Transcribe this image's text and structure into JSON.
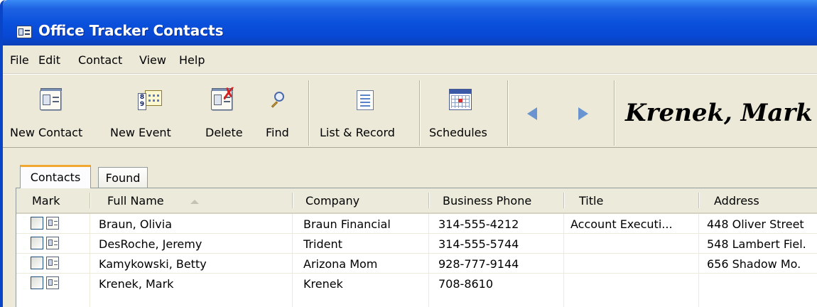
{
  "window": {
    "title": "Office Tracker Contacts"
  },
  "menu": [
    "File",
    "Edit",
    "Contact",
    "View",
    "Help"
  ],
  "toolbar": {
    "new_contact": "New Contact",
    "new_event": "New Event",
    "delete": "Delete",
    "find": "Find",
    "list_record": "List & Record",
    "schedules": "Schedules"
  },
  "current_contact": "Krenek, Mark",
  "tabs": [
    "Contacts",
    "Found"
  ],
  "table": {
    "columns": [
      "Mark",
      "Full Name",
      "Company",
      "Business Phone",
      "Title",
      "Address"
    ],
    "sort_column": "Full Name",
    "rows": [
      {
        "full_name": "Braun, Olivia",
        "company": "Braun Financial",
        "phone": "314-555-4212",
        "title": "Account Executi...",
        "address": "448 Oliver Street"
      },
      {
        "full_name": "DesRoche, Jeremy",
        "company": "Trident",
        "phone": "314-555-5744",
        "title": "",
        "address": "548 Lambert Fiel."
      },
      {
        "full_name": "Kamykowski, Betty",
        "company": "Arizona Mom",
        "phone": "928-777-9144",
        "title": "",
        "address": "656 Shadow Mo."
      },
      {
        "full_name": "Krenek, Mark",
        "company": "Krenek",
        "phone": "708-8610",
        "title": "",
        "address": ""
      }
    ]
  },
  "colors": {
    "titlebar": "#0a51dc",
    "chrome": "#ece9d8",
    "active_tab_accent": "#f0a830"
  }
}
